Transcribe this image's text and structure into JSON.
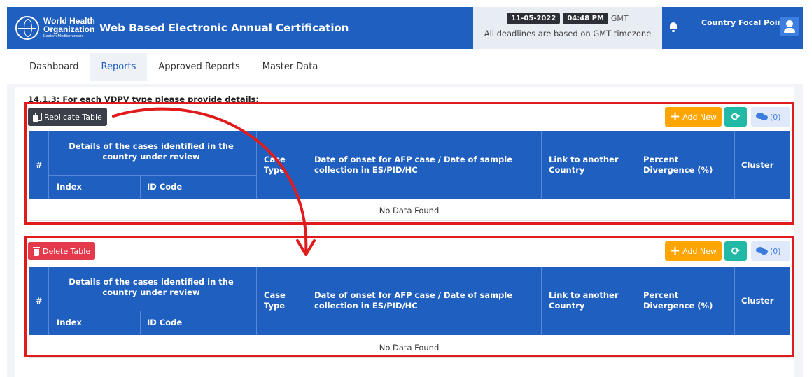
{
  "header": {
    "org_line1": "World Health",
    "org_line2": "Organization",
    "org_region": "Eastern Mediterranean",
    "app_title": "Web Based Electronic Annual Certification",
    "date": "11-05-2022",
    "time": "04:48 PM",
    "timezone": "GMT",
    "deadline_note": "All deadlines are based on GMT timezone",
    "user_role": "Country Focal Point",
    "brand_color": "#1f5fbf",
    "icons": [
      "who-logo-icon",
      "bell-icon",
      "user-icon"
    ]
  },
  "nav": {
    "items": [
      {
        "label": "Dashboard",
        "active": false
      },
      {
        "label": "Reports",
        "active": true
      },
      {
        "label": "Approved Reports",
        "active": false
      },
      {
        "label": "Master Data",
        "active": false
      }
    ]
  },
  "content": {
    "question": "14.1.3: For each VDPV type please provide details:",
    "tables": [
      {
        "action_label": "Replicate Table",
        "action_icon": "copy-icon",
        "add_new_label": "Add New",
        "comments_count": "(0)",
        "empty_text": "No Data Found"
      },
      {
        "action_label": "Delete Table",
        "action_icon": "trash-icon",
        "add_new_label": "Add New",
        "comments_count": "(0)",
        "empty_text": "No Data Found"
      }
    ],
    "columns": {
      "number": "#",
      "details_group": "Details of the cases identified in the country under review",
      "index": "Index",
      "id_code": "ID Code",
      "case_type": "Case Type",
      "onset_date": "Date of onset for AFP case / Date of sample collection in ES/PID/HC",
      "link_country": "Link to another Country",
      "percent_divergence": "Percent Divergence (%)",
      "cluster": "Cluster"
    },
    "annotation_color": "#e01b1b"
  }
}
